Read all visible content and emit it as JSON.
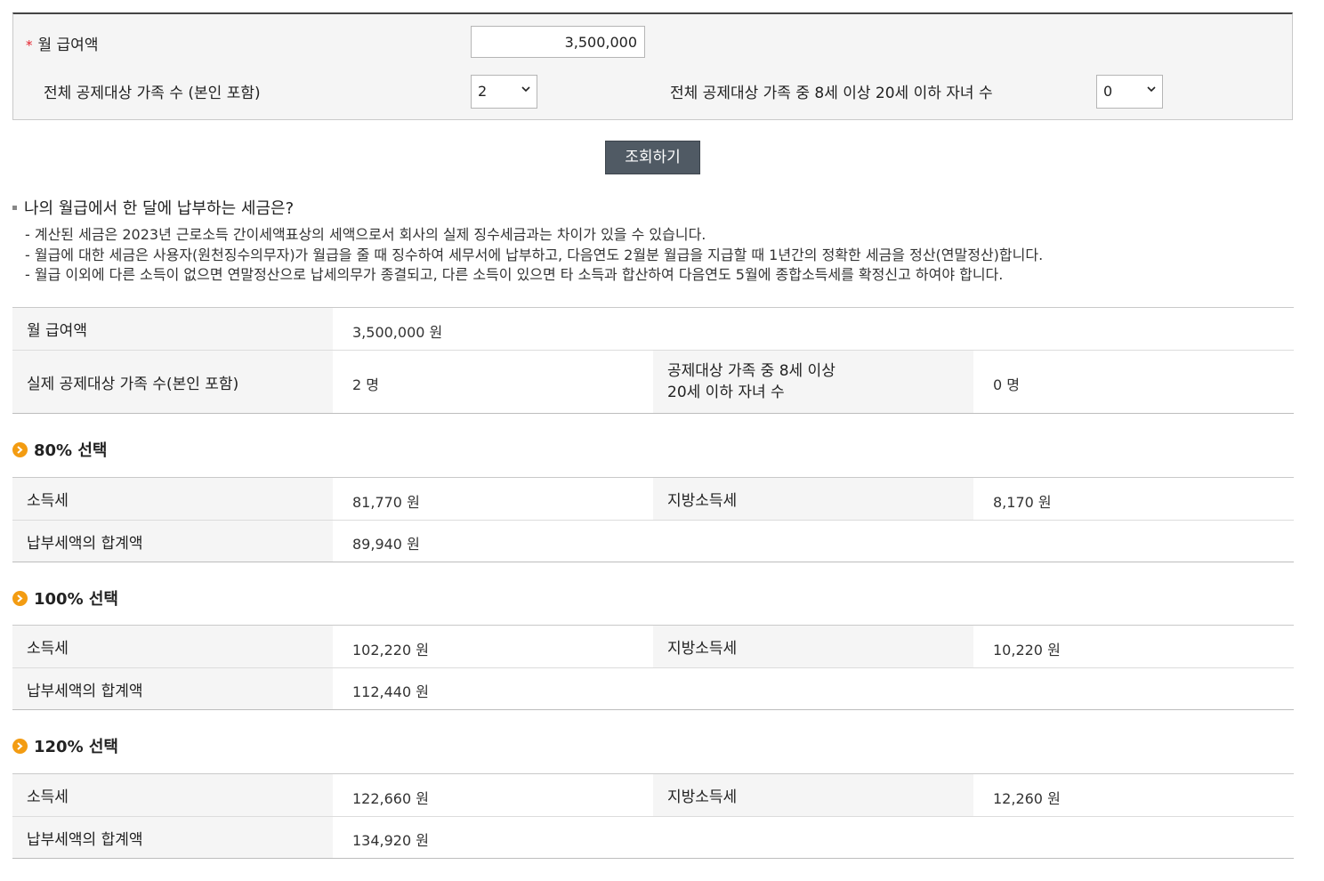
{
  "form": {
    "salary_label": "월 급여액",
    "required_mark": "*",
    "salary_value": "3,500,000",
    "family_label": "전체 공제대상 가족 수 (본인 포함)",
    "family_value": "2",
    "children_label": "전체 공제대상 가족 중 8세 이상 20세 이하 자녀 수",
    "children_value": "0",
    "search_button": "조회하기"
  },
  "result": {
    "title": "나의 월급에서 한 달에 납부하는 세금은?",
    "notes": [
      "- 계산된 세금은  2023년  근로소득 간이세액표상의 세액으로서 회사의 실제 징수세금과는 차이가 있을 수 있습니다.",
      "- 월급에 대한 세금은 사용자(원천징수의무자)가 월급을 줄 때 징수하여 세무서에 납부하고, 다음연도 2월분 월급을 지급할 때 1년간의 정확한 세금을 정산(연말정산)합니다.",
      "- 월급 이외에 다른 소득이 없으면 연말정산으로 납세의무가 종결되고, 다른 소득이 있으면 타 소득과 합산하여 다음연도 5월에 종합소득세를 확정신고 하여야 합니다."
    ],
    "summary": {
      "salary_label": "월 급여액",
      "salary_value": "3,500,000  원",
      "family_label": "실제 공제대상 가족 수(본인 포함)",
      "family_value": "2  명",
      "children_label_1": "공제대상 가족 중 8세 이상",
      "children_label_2": "20세 이하 자녀 수",
      "children_value": "0  명"
    }
  },
  "options": [
    {
      "title": "80% 선택",
      "income_tax_label": "소득세",
      "income_tax": "81,770  원",
      "local_tax_label": "지방소득세",
      "local_tax": "8,170  원",
      "total_label": "납부세액의 합계액",
      "total": "89,940  원"
    },
    {
      "title": "100% 선택",
      "income_tax_label": "소득세",
      "income_tax": "102,220  원",
      "local_tax_label": "지방소득세",
      "local_tax": "10,220  원",
      "total_label": "납부세액의 합계액",
      "total": "112,440  원"
    },
    {
      "title": "120% 선택",
      "income_tax_label": "소득세",
      "income_tax": "122,660  원",
      "local_tax_label": "지방소득세",
      "local_tax": "12,260  원",
      "total_label": "납부세액의 합계액",
      "total": "134,920  원"
    }
  ],
  "colors": {
    "accent_button": "#505a64",
    "required": "#e5212c",
    "bullet": "#f39c12",
    "link": "#1a4f8e"
  }
}
